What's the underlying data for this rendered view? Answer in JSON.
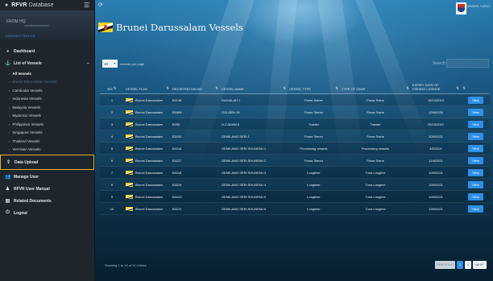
{
  "app": {
    "brand_bold": "RFVR",
    "brand_light": "Database",
    "user_name": "FROM HQ",
    "user_email": "sdsdlsdsdsdsdsd",
    "user_role": "ADMINISTRATOR"
  },
  "topbar": {
    "username": "Random Admin"
  },
  "sidebar": {
    "dashboard": "Dashboard",
    "list_of_vessels": "List of Vessels",
    "sub_items": [
      "All Vessels",
      "Brunei Darussalam Vessels",
      "Cambodia Vessels",
      "Indonesia Vessels",
      "Malaysia Vessels",
      "Myanmar Vessels",
      "Philippines Vessels",
      "Singapore Vessels",
      "Thailand Vessels",
      "Viet Nam Vessels"
    ],
    "data_upload": "Data Upload",
    "manage_user": "Manage User",
    "user_manual": "RFVR User Manual",
    "related_documents": "Related Documents",
    "logout": "Logout"
  },
  "page": {
    "title": "Brunei Darussalam Vessels",
    "page_size": "10",
    "records_label": "records per page",
    "search_label": "Search:",
    "footer": "Showing 1 to 10 of 11 entries"
  },
  "table": {
    "headers": {
      "no": "NO.",
      "flag": "VESSEL FLAG",
      "reg": "REGISTRATION NO.",
      "name": "VESSEL NAME",
      "type": "VESSEL TYPE",
      "gear": "TYPE OF GEAR",
      "expiry_1": "EXPIRY DATE OF",
      "expiry_2": "FISHING LICENSE"
    },
    "view_label": "View",
    "rows": [
      {
        "no": "1",
        "flag": "Brunei Darussalam",
        "reg": "B1148",
        "name": "SUHAILAH 1",
        "type": "Purse Seiner",
        "gear": "Purse Seine",
        "expiry": "16/12/2019"
      },
      {
        "no": "2",
        "flag": "Brunei Darussalam",
        "reg": "B1866",
        "name": "GOLDEN 15",
        "type": "Purse Seiner",
        "gear": "Purse Seine",
        "expiry": "12/6/2020"
      },
      {
        "no": "3",
        "flag": "Brunei Darussalam",
        "reg": "B255",
        "name": "H.Z ADAM II",
        "type": "Trawler",
        "gear": "Trawler",
        "expiry": "25/10/2021"
      },
      {
        "no": "4",
        "flag": "Brunei Darussalam",
        "reg": "B3191",
        "name": "GEMILANG SERI 1",
        "type": "Purse Seiner",
        "gear": "Purse Seine",
        "expiry": "20/5/2021"
      },
      {
        "no": "5",
        "flag": "Brunei Darussalam",
        "reg": "B4116",
        "name": "GEMILANG SERI SHUNFAN 1",
        "type": "Processing vessels",
        "gear": "Processing vessels",
        "expiry": "4/5/2021"
      },
      {
        "no": "6",
        "flag": "Brunei Darussalam",
        "reg": "B4117",
        "name": "GEMILANG SERI SHUNFAN 2",
        "type": "Purse Seiner",
        "gear": "Purse Seine",
        "expiry": "11/8/2021"
      },
      {
        "no": "7",
        "flag": "Brunei Darussalam",
        "reg": "B4118",
        "name": "GEMILANG SERI SHUNFAN 3",
        "type": "Longliner",
        "gear": "Tuna Longline",
        "expiry": "19/5/2021"
      },
      {
        "no": "8",
        "flag": "Brunei Darussalam",
        "reg": "B4119",
        "name": "GEMILANG SERI SHUNFAN 4",
        "type": "Longliner",
        "gear": "Tuna Longline",
        "expiry": "19/5/2021"
      },
      {
        "no": "9",
        "flag": "Brunei Darussalam",
        "reg": "B4120",
        "name": "GEMILANG SERI SHUNFAN 5",
        "type": "Longliner",
        "gear": "Tuna Longline",
        "expiry": "19/5/2021"
      },
      {
        "no": "10",
        "flag": "Brunei Darussalam",
        "reg": "B4121",
        "name": "GEMILANG SERI SHUNFAN 6",
        "type": "Longliner",
        "gear": "Tuna Longline",
        "expiry": "19/5/2021"
      }
    ]
  },
  "pagination": {
    "previous": "PREVIOUS",
    "pages": [
      "1",
      "2"
    ],
    "next": "NEXT"
  },
  "colors": {
    "accent": "#2f8fe6",
    "highlight": "#e2b23a",
    "sidebar": "#1e252c"
  }
}
